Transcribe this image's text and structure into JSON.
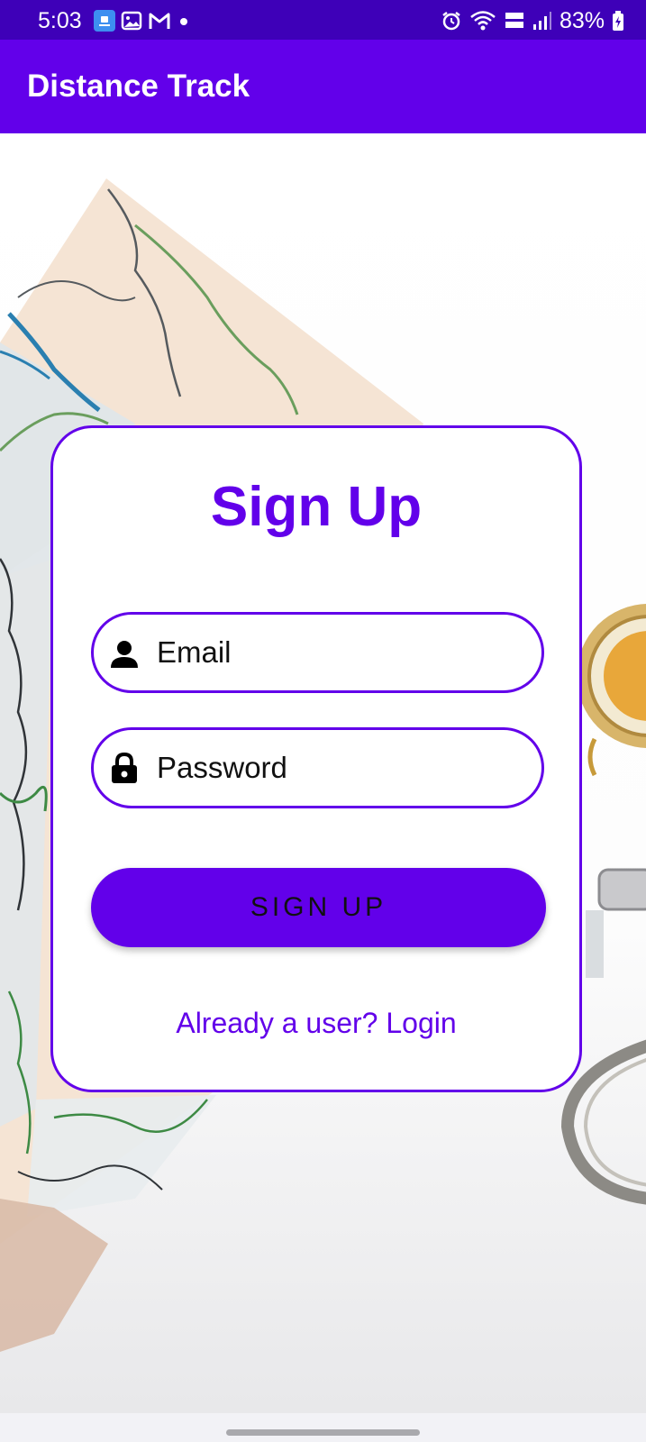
{
  "status_bar": {
    "time": "5:03",
    "battery": "83%",
    "left_icons": [
      "app-notification-icon",
      "gallery-icon",
      "gmail-icon",
      "more-dot-icon"
    ],
    "right_icons": [
      "alarm-icon",
      "wifi-icon",
      "volte-icon",
      "signal-icon",
      "battery-charging-icon"
    ]
  },
  "app_bar": {
    "title": "Distance Track"
  },
  "signup": {
    "title": "Sign Up",
    "email_placeholder": "Email",
    "password_placeholder": "Password",
    "button_label": "SIGN UP",
    "login_link": "Already a user? Login"
  },
  "colors": {
    "primary": "#6200ea",
    "status_bar": "#3e00b8"
  }
}
